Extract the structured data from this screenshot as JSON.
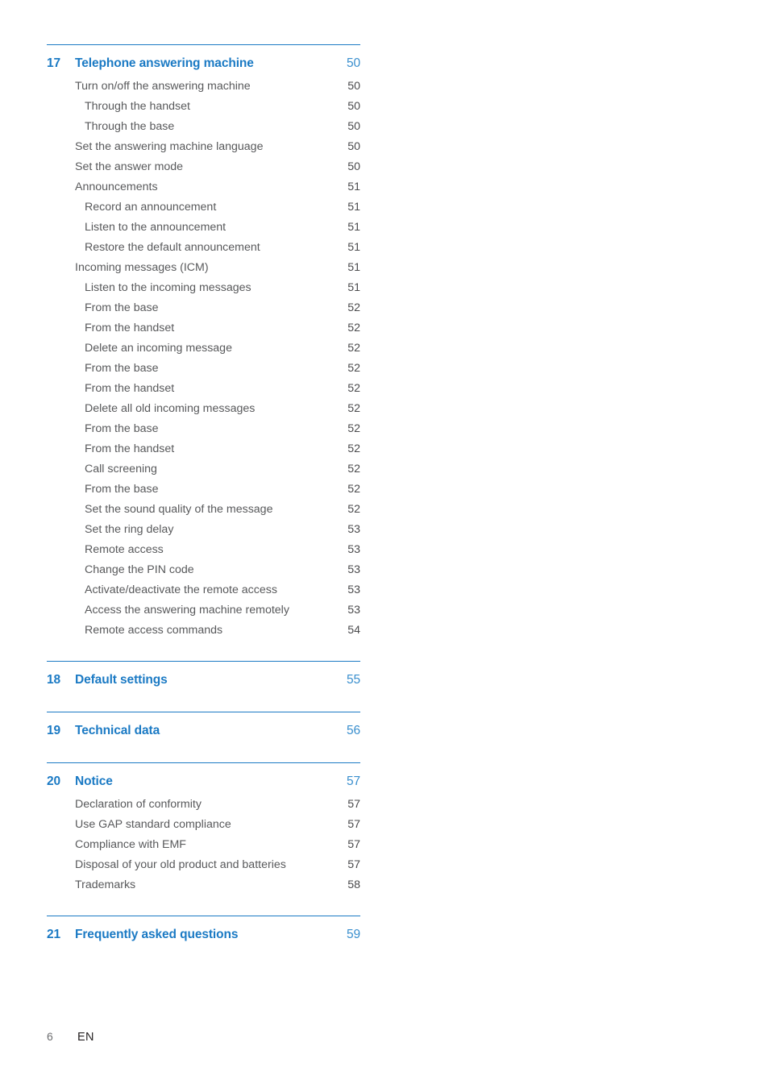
{
  "document": {
    "type": "table-of-contents",
    "language_code": "EN",
    "page_number": "6",
    "accent_color": "#1b7ac4",
    "body_text_color": "#58595b",
    "background_color": "#ffffff"
  },
  "footer": {
    "folio": "6",
    "language": "EN"
  },
  "sections": [
    {
      "number": "17",
      "title": "Telephone answering machine",
      "page": "50",
      "entries": [
        {
          "label": "Turn on/off the answering machine",
          "page": "50",
          "level": 1
        },
        {
          "label": "Through the handset",
          "page": "50",
          "level": 2
        },
        {
          "label": "Through the base",
          "page": "50",
          "level": 2
        },
        {
          "label": "Set the answering machine language",
          "page": "50",
          "level": 1
        },
        {
          "label": "Set the answer mode",
          "page": "50",
          "level": 1
        },
        {
          "label": "Announcements",
          "page": "51",
          "level": 1
        },
        {
          "label": "Record an announcement",
          "page": "51",
          "level": 2
        },
        {
          "label": "Listen to the announcement",
          "page": "51",
          "level": 2
        },
        {
          "label": "Restore the default announcement",
          "page": "51",
          "level": 2
        },
        {
          "label": "Incoming messages (ICM)",
          "page": "51",
          "level": 1
        },
        {
          "label": "Listen to the incoming messages",
          "page": "51",
          "level": 2
        },
        {
          "label": "From the base",
          "page": "52",
          "level": 2
        },
        {
          "label": "From the handset",
          "page": "52",
          "level": 2
        },
        {
          "label": "Delete an incoming message",
          "page": "52",
          "level": 2
        },
        {
          "label": "From the base",
          "page": "52",
          "level": 2
        },
        {
          "label": "From the handset",
          "page": "52",
          "level": 2
        },
        {
          "label": "Delete all old incoming messages",
          "page": "52",
          "level": 2
        },
        {
          "label": "From the base",
          "page": "52",
          "level": 2
        },
        {
          "label": "From the handset",
          "page": "52",
          "level": 2
        },
        {
          "label": "Call screening",
          "page": "52",
          "level": 2
        },
        {
          "label": "From the base",
          "page": "52",
          "level": 2
        },
        {
          "label": "Set the sound quality of the message",
          "page": "52",
          "level": 2
        },
        {
          "label": "Set the ring delay",
          "page": "53",
          "level": 2
        },
        {
          "label": "Remote access",
          "page": "53",
          "level": 2
        },
        {
          "label": "Change the PIN code",
          "page": "53",
          "level": 2
        },
        {
          "label": "Activate/deactivate the remote access",
          "page": "53",
          "level": 2
        },
        {
          "label": "Access the answering machine remotely",
          "page": "53",
          "level": 2
        },
        {
          "label": "Remote access commands",
          "page": "54",
          "level": 2
        }
      ]
    },
    {
      "number": "18",
      "title": "Default settings",
      "page": "55",
      "entries": []
    },
    {
      "number": "19",
      "title": "Technical data",
      "page": "56",
      "entries": []
    },
    {
      "number": "20",
      "title": "Notice",
      "page": "57",
      "entries": [
        {
          "label": "Declaration of conformity",
          "page": "57",
          "level": 1
        },
        {
          "label": "Use GAP standard compliance",
          "page": "57",
          "level": 1
        },
        {
          "label": "Compliance with EMF",
          "page": "57",
          "level": 1
        },
        {
          "label": "Disposal of your old product and batteries",
          "page": "57",
          "level": 1
        },
        {
          "label": "Trademarks",
          "page": "58",
          "level": 1
        }
      ]
    },
    {
      "number": "21",
      "title": "Frequently asked questions",
      "page": "59",
      "entries": []
    }
  ]
}
